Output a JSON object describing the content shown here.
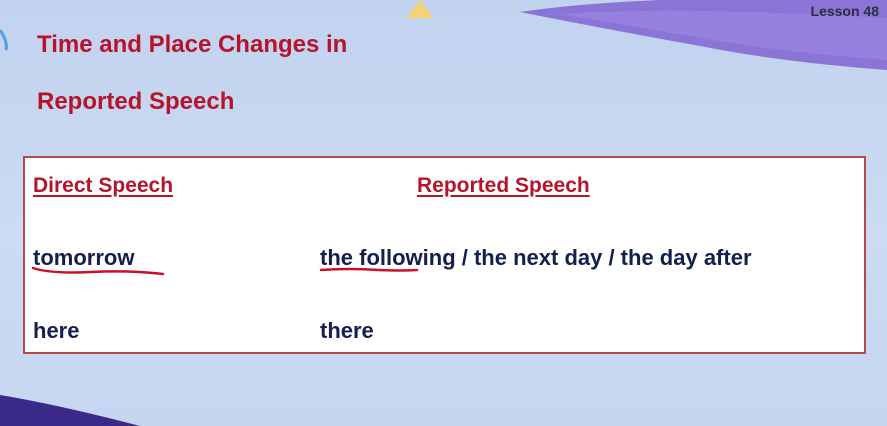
{
  "header": {
    "lesson": "Lesson 48"
  },
  "title": {
    "line1": "Time and Place Changes in",
    "line2": "Reported Speech"
  },
  "table": {
    "headers": [
      "Direct Speech",
      "Reported Speech"
    ],
    "rows": [
      {
        "direct": "tomorrow",
        "reported": "the following / the next day / the day after"
      },
      {
        "direct": "here",
        "reported": "there"
      }
    ]
  },
  "colors": {
    "title": "#b5142b",
    "body_text": "#141f4d",
    "border": "#b64a4a",
    "annotation_ink": "#c8102e",
    "background": "#c9d8f2"
  }
}
